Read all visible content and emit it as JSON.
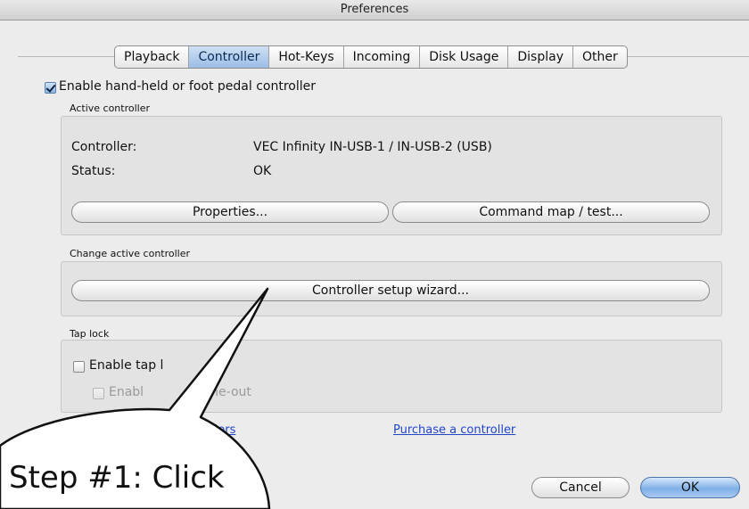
{
  "window": {
    "title": "Preferences"
  },
  "tabs": [
    {
      "label": "Playback",
      "active": false
    },
    {
      "label": "Controller",
      "active": true
    },
    {
      "label": "Hot-Keys",
      "active": false
    },
    {
      "label": "Incoming",
      "active": false
    },
    {
      "label": "Disk Usage",
      "active": false
    },
    {
      "label": "Display",
      "active": false
    },
    {
      "label": "Other",
      "active": false
    }
  ],
  "enable_controller": {
    "label": "Enable hand-held or foot pedal controller",
    "checked": true
  },
  "active_controller": {
    "heading": "Active controller",
    "controller_label": "Controller:",
    "controller_value": "VEC Infinity IN-USB-1 / IN-USB-2 (USB)",
    "status_label": "Status:",
    "status_value": "OK",
    "properties_button": "Properties...",
    "command_map_button": "Command map / test..."
  },
  "change_controller": {
    "heading": "Change active controller",
    "wizard_button": "Controller setup wizard..."
  },
  "tap_lock": {
    "heading": "Tap lock",
    "enable_label": "Enable tap l",
    "timeout_label_start": "Enabl",
    "timeout_label_end": "time-out"
  },
  "links": {
    "left_partial": "llers",
    "purchase": "Purchase a controller"
  },
  "buttons": {
    "cancel": "Cancel",
    "ok": "OK"
  },
  "callout": {
    "text": "Step #1: Click"
  }
}
